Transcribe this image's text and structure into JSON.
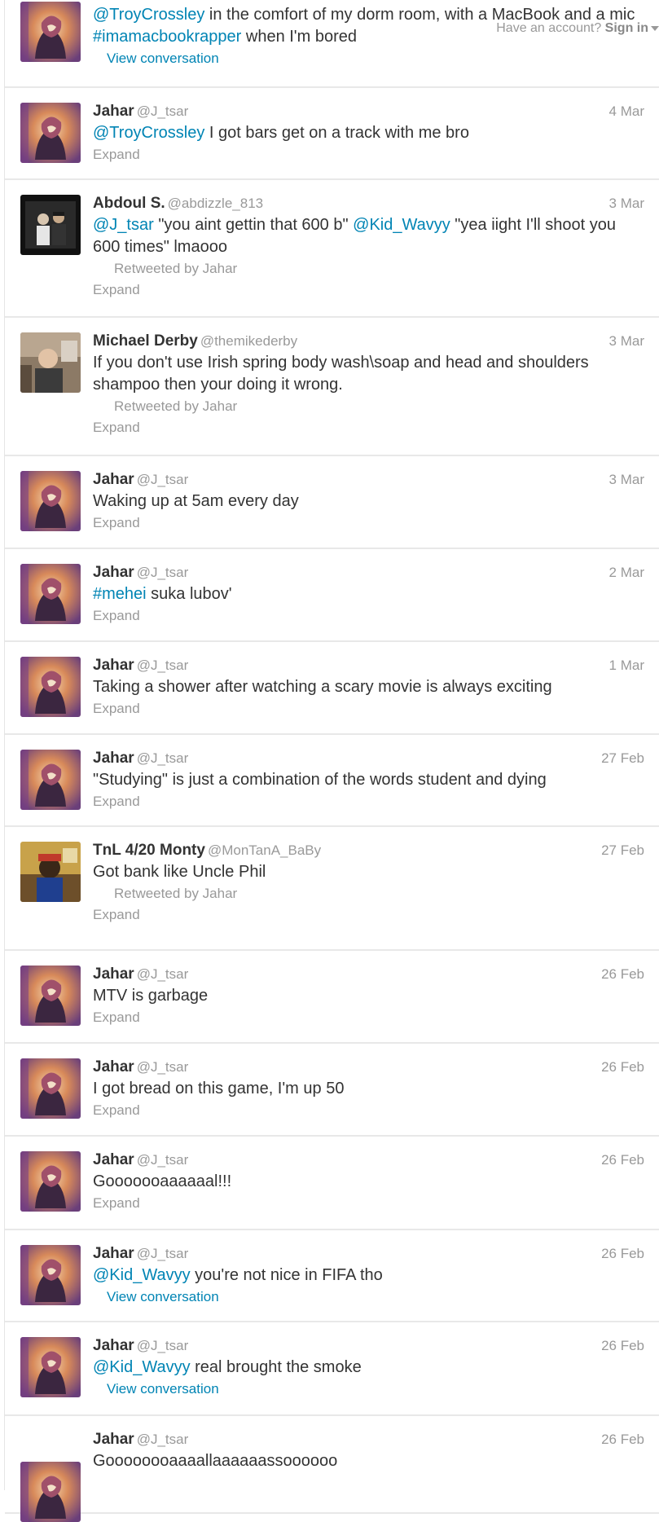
{
  "topbar": {
    "have_account": "Have an account?",
    "sign_in": "Sign in"
  },
  "tweets": [
    {
      "avatar": "jahar",
      "parts": [
        {
          "t": "@TroyCrossley",
          "link": true
        },
        {
          "t": " in the comfort of my dorm room, with a MacBook and a mic "
        },
        {
          "t": "#imamacbookrapper",
          "link": true
        },
        {
          "t": " when I'm bored"
        }
      ],
      "action": "View conversation"
    },
    {
      "avatar": "jahar",
      "name": "Jahar",
      "handle": "@J_tsar",
      "time": "4 Mar",
      "parts": [
        {
          "t": "@TroyCrossley",
          "link": true
        },
        {
          "t": " I got bars get on a track with me bro"
        }
      ],
      "action": "Expand"
    },
    {
      "avatar": "abdoul",
      "name": "Abdoul S.",
      "handle": "@abdizzle_813",
      "time": "3 Mar",
      "parts": [
        {
          "t": "@J_tsar",
          "link": true
        },
        {
          "t": " \"you aint gettin that 600 b\"      "
        },
        {
          "t": "@Kid_Wavyy",
          "link": true
        },
        {
          "t": " \"yea iight I'll shoot you 600 times\" lmaooo"
        }
      ],
      "retweeted": "Retweeted by Jahar",
      "action": "Expand"
    },
    {
      "avatar": "derby",
      "name": "Michael Derby",
      "handle": "@themikederby",
      "time": "3 Mar",
      "parts": [
        {
          "t": "If you don't use Irish spring body wash\\soap and head and shoulders shampoo then your doing it wrong."
        }
      ],
      "retweeted": "Retweeted by Jahar",
      "action": "Expand"
    },
    {
      "avatar": "jahar",
      "name": "Jahar",
      "handle": "@J_tsar",
      "time": "3 Mar",
      "parts": [
        {
          "t": "Waking up at 5am every day"
        }
      ],
      "action": "Expand"
    },
    {
      "avatar": "jahar",
      "name": "Jahar",
      "handle": "@J_tsar",
      "time": "2 Mar",
      "parts": [
        {
          "t": "#mehei",
          "link": true
        },
        {
          "t": " suka lubov'"
        }
      ],
      "action": "Expand"
    },
    {
      "avatar": "jahar",
      "name": "Jahar",
      "handle": "@J_tsar",
      "time": "1 Mar",
      "parts": [
        {
          "t": "Taking a shower after watching a scary movie is always exciting"
        }
      ],
      "action": "Expand"
    },
    {
      "avatar": "jahar",
      "name": "Jahar",
      "handle": "@J_tsar",
      "time": "27 Feb",
      "parts": [
        {
          "t": "\"Studying\" is just a combination of the words student and dying"
        }
      ],
      "action": "Expand"
    },
    {
      "avatar": "monty",
      "name": "TnL 4/20 Monty",
      "handle": "@MonTanA_BaBy",
      "time": "27 Feb",
      "parts": [
        {
          "t": "Got bank like Uncle Phil"
        }
      ],
      "retweeted": "Retweeted by Jahar",
      "action": "Expand"
    },
    {
      "avatar": "jahar",
      "name": "Jahar",
      "handle": "@J_tsar",
      "time": "26 Feb",
      "parts": [
        {
          "t": "MTV is garbage"
        }
      ],
      "action": "Expand"
    },
    {
      "avatar": "jahar",
      "name": "Jahar",
      "handle": "@J_tsar",
      "time": "26 Feb",
      "parts": [
        {
          "t": "I got bread on this game, I'm up 50"
        }
      ],
      "action": "Expand"
    },
    {
      "avatar": "jahar",
      "name": "Jahar",
      "handle": "@J_tsar",
      "time": "26 Feb",
      "parts": [
        {
          "t": "Gooooooaaaaaal!!!"
        }
      ],
      "action": "Expand"
    },
    {
      "avatar": "jahar",
      "name": "Jahar",
      "handle": "@J_tsar",
      "time": "26 Feb",
      "parts": [
        {
          "t": "@Kid_Wavyy",
          "link": true
        },
        {
          "t": " you're not nice in FIFA tho"
        }
      ],
      "action": "View conversation"
    },
    {
      "avatar": "jahar",
      "name": "Jahar",
      "handle": "@J_tsar",
      "time": "26 Feb",
      "parts": [
        {
          "t": "@Kid_Wavyy",
          "link": true
        },
        {
          "t": " real brought the smoke"
        }
      ],
      "action": "View conversation"
    },
    {
      "avatar": "jahar",
      "name": "Jahar",
      "handle": "@J_tsar",
      "time": "26 Feb",
      "parts": [
        {
          "t": "Goooooooaaaallaaaaaassoooooo"
        }
      ]
    }
  ],
  "colors": {
    "link": "#0084b4",
    "muted": "#999999",
    "text": "#333333",
    "divider": "#e8e8e8"
  }
}
